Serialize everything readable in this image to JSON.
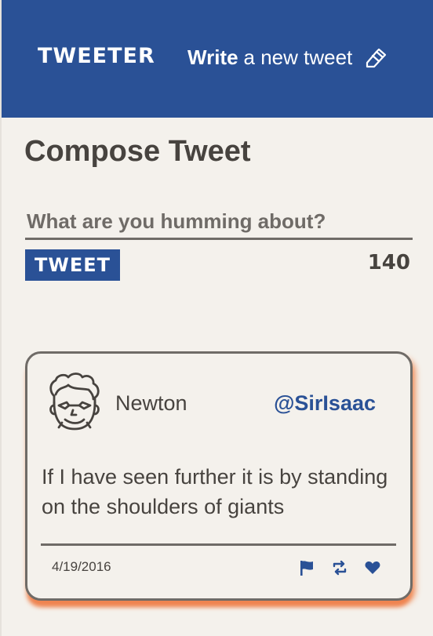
{
  "nav": {
    "brand": "TWEETER",
    "write_bold": "Write",
    "write_rest": "a new tweet",
    "pen_icon": "edit-icon"
  },
  "compose": {
    "title": "Compose Tweet",
    "placeholder": "What are you humming about?",
    "value": "",
    "submit_label": "TWEET",
    "counter": "140"
  },
  "tweets": [
    {
      "name": "Newton",
      "handle": "@SirIsaac",
      "text": "If I have seen further it is by standing on the shoulders of giants",
      "date": "4/19/2016",
      "actions": [
        "flag-icon",
        "retweet-icon",
        "heart-icon"
      ]
    }
  ],
  "colors": {
    "primary": "#2a5196",
    "background": "#f4f1ec",
    "text": "#47433f",
    "shadow": "#ef8450"
  }
}
